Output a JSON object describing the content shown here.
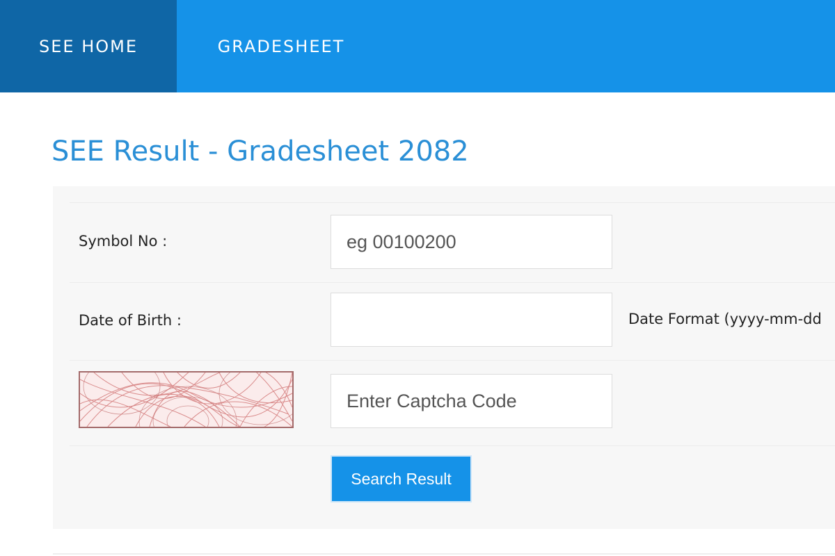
{
  "nav": {
    "home_label": "SEE HOME",
    "gradesheet_label": "GRADESHEET",
    "active_color": "#0f66a6",
    "bar_color": "#1592e8"
  },
  "page": {
    "title": "SEE Result - Gradesheet 2082"
  },
  "form": {
    "symbol_label": "Symbol No :",
    "symbol_placeholder": "eg 00100200",
    "symbol_value": "",
    "dob_label": "Date of Birth :",
    "dob_value": "",
    "dob_hint": "Date Format (yyyy-mm-dd",
    "captcha_image": "captcha-image",
    "captcha_placeholder": "Enter Captcha Code",
    "captcha_value": "",
    "submit_label": "Search Result",
    "accent_color": "#1592e8"
  }
}
